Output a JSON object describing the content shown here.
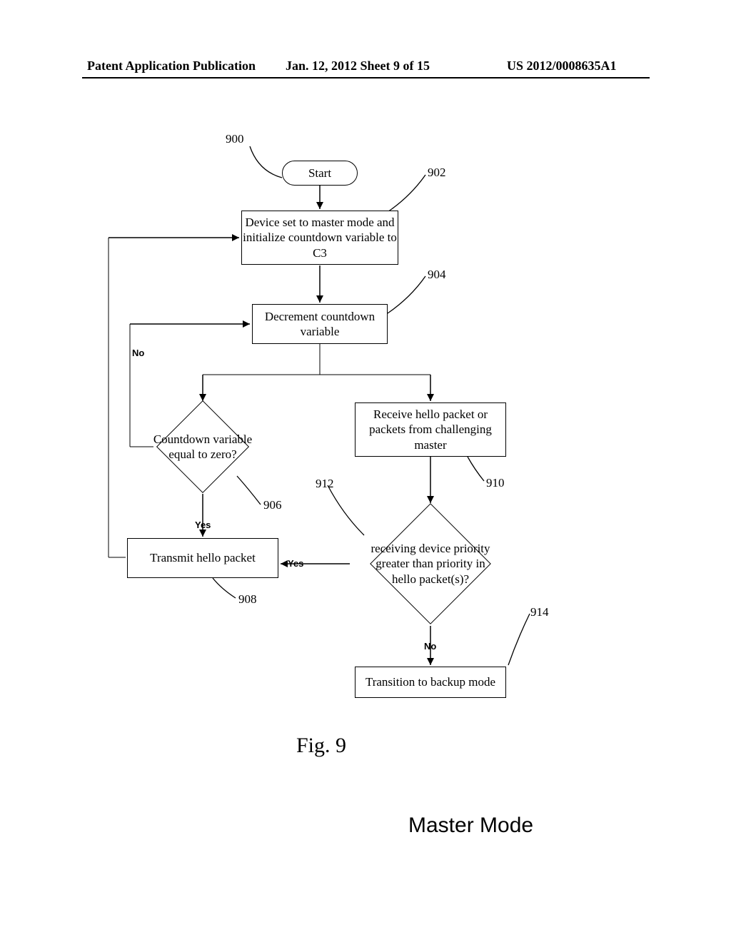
{
  "header": {
    "left": "Patent Application Publication",
    "center": "Jan. 12, 2012   Sheet 9 of 15",
    "right": "US 2012/0008635A1"
  },
  "refs": {
    "r900": "900",
    "r902": "902",
    "r904": "904",
    "r906": "906",
    "r908": "908",
    "r910": "910",
    "r912": "912",
    "r914": "914"
  },
  "blocks": {
    "start": "Start",
    "b902": "Device set to master mode and initialize countdown variable to C3",
    "b904": "Decrement countdown variable",
    "d906": "Countdown variable equal to zero?",
    "b908": "Transmit hello packet",
    "b910": "Receive hello packet or packets from challenging master",
    "d912": "receiving device priority greater than priority in hello packet(s)?",
    "b914": "Transition to backup mode"
  },
  "labels": {
    "yes": "Yes",
    "no": "No"
  },
  "figure": "Fig. 9",
  "subtitle": "Master Mode"
}
